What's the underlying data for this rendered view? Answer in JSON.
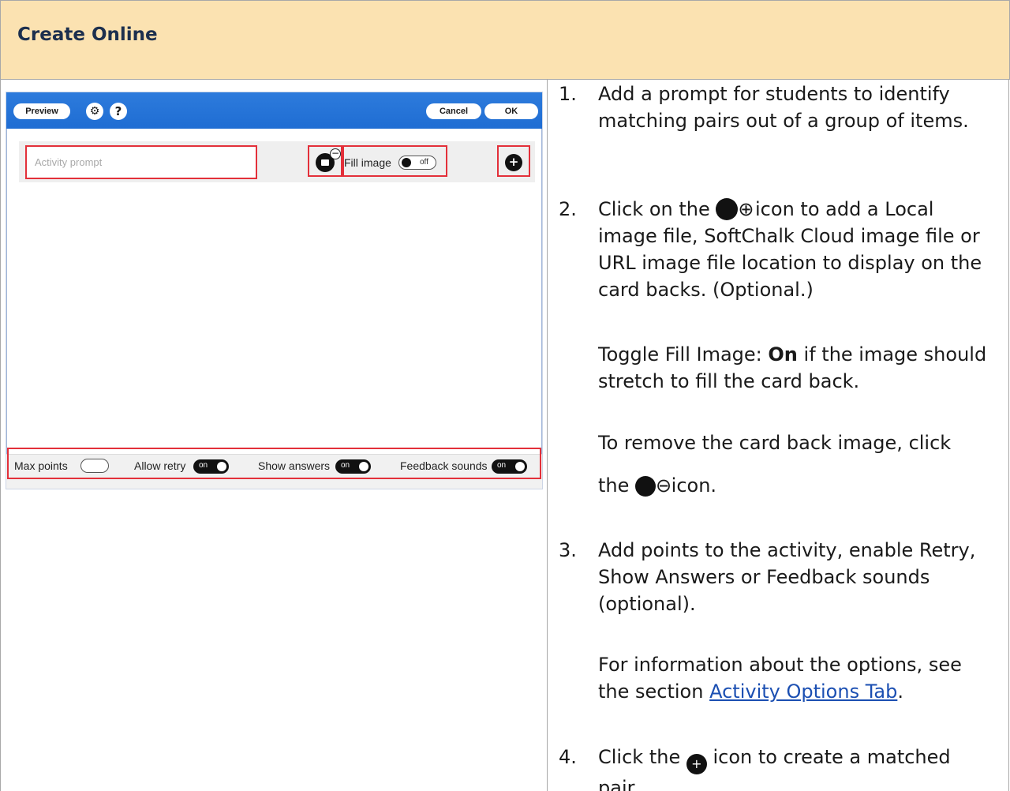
{
  "header": {
    "title": "Create Online"
  },
  "editor": {
    "toolbar": {
      "preview": "Preview",
      "cancel": "Cancel",
      "ok": "OK",
      "help": "?"
    },
    "prompt_placeholder": "Activity prompt",
    "fill_image_label": "Fill image",
    "fill_toggle": "off",
    "options": {
      "max_points": "Max points",
      "allow_retry": "Allow retry",
      "show_answers": "Show answers",
      "feedback_sounds": "Feedback sounds",
      "on": "on"
    },
    "icons": [
      "gear-icon",
      "help-icon",
      "image-icon",
      "minus-icon",
      "plus-icon"
    ]
  },
  "steps": {
    "s1": {
      "num": "1.",
      "text": "Add a prompt for students to identify matching pairs out of a group of items."
    },
    "s2": {
      "num": "2.",
      "a": "Click on the",
      "b": "icon to add a Local image file, SoftChalk Cloud image file or URL image file location to display on the card backs. (Optional.)",
      "toggle_a": "Toggle Fill Image:",
      "toggle_b": "On",
      "toggle_c": "if the image should stretch to fill the card back.",
      "remove_a": "To remove the card back image, click",
      "remove_b": "the",
      "remove_c": "icon."
    },
    "s3": {
      "num": "3.",
      "text": "Add points to the activity, enable Retry, Show Answers or Feedback sounds (optional).",
      "info_a": "For information about the options, see the section",
      "info_link": "Activity Options Tab",
      "info_c": "."
    },
    "s4": {
      "num": "4.",
      "a": "Click the",
      "b": "icon to create a matched pair."
    }
  },
  "colors": {
    "header_bg": "#fbe2b1",
    "title": "#1c2f4e",
    "toolbar": "#2d7bdc",
    "highlight": "#e3303a",
    "link": "#1b4fb2"
  }
}
